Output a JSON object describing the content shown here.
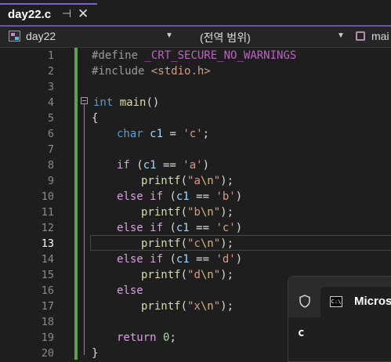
{
  "tab": {
    "title": "day22.c",
    "pin_glyph": "⊣",
    "close_glyph": "✕"
  },
  "nav": {
    "file": "day22",
    "scope": "(전역 범위)",
    "member": "mai",
    "arrow": "▼"
  },
  "editor": {
    "active_line": 13,
    "line_numbers": [
      "1",
      "2",
      "3",
      "4",
      "5",
      "6",
      "7",
      "8",
      "9",
      "10",
      "11",
      "12",
      "13",
      "14",
      "15",
      "16",
      "17",
      "18",
      "19",
      "20"
    ],
    "lines": {
      "l1": {
        "kw": "#define",
        "macro": "_CRT_SECURE_NO_WARNINGS"
      },
      "l2": {
        "kw": "#include",
        "inc": "<stdio.h>"
      },
      "l4": {
        "type": "int",
        "fn": "main",
        "rest": "()"
      },
      "l5": {
        "text": "{"
      },
      "l6": {
        "type": "char",
        "var": "c1",
        "op": " = ",
        "str": "'c'",
        "end": ";"
      },
      "l8": {
        "kw": "if",
        "open": " (",
        "var": "c1",
        "op": " == ",
        "str": "'a'",
        "close": ")"
      },
      "l9": {
        "fn": "printf",
        "open": "(",
        "str1": "\"a",
        "esc": "\\n",
        "str2": "\"",
        "end": ");"
      },
      "l10": {
        "kw": "else if",
        "open": " (",
        "var": "c1",
        "op": " == ",
        "str": "'b'",
        "close": ")"
      },
      "l11": {
        "fn": "printf",
        "open": "(",
        "str1": "\"b",
        "esc": "\\n",
        "str2": "\"",
        "end": ");"
      },
      "l12": {
        "kw": "else if",
        "open": " (",
        "var": "c1",
        "op": " == ",
        "str": "'c'",
        "close": ")"
      },
      "l13": {
        "fn": "printf",
        "open": "(",
        "str1": "\"c",
        "esc": "\\n",
        "str2": "\"",
        "end": ");"
      },
      "l14": {
        "kw": "else if",
        "open": " (",
        "var": "c1",
        "op": " == ",
        "str": "'d'",
        "close": ")"
      },
      "l15": {
        "fn": "printf",
        "open": "(",
        "str1": "\"d",
        "esc": "\\n",
        "str2": "\"",
        "end": ");"
      },
      "l16": {
        "kw": "else"
      },
      "l17": {
        "fn": "printf",
        "open": "(",
        "str1": "\"x",
        "esc": "\\n",
        "str2": "\"",
        "end": ");"
      },
      "l19": {
        "kw": "return",
        "num": "0",
        "end": ";"
      },
      "l20": {
        "text": "}"
      }
    }
  },
  "console_popup": {
    "title": "Microso",
    "icon_text": "C:\\",
    "body": "c"
  }
}
